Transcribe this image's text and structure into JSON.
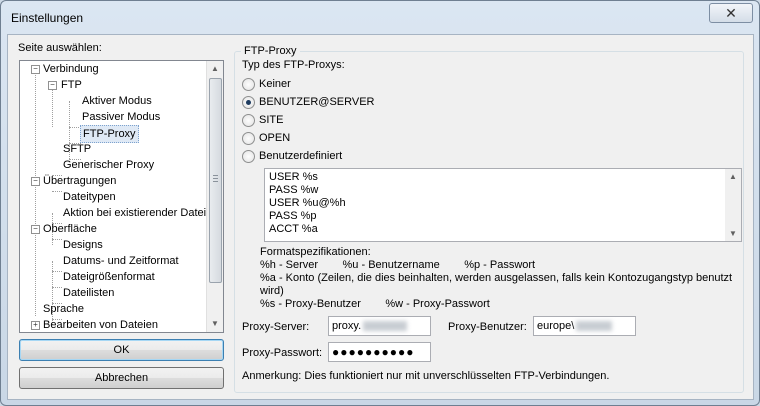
{
  "window": {
    "title": "Einstellungen",
    "close_symbol": "✕"
  },
  "sidebar": {
    "label": "Seite auswählen:",
    "items": [
      {
        "label": "Verbindung"
      },
      {
        "label": "FTP"
      },
      {
        "label": "Aktiver Modus"
      },
      {
        "label": "Passiver Modus"
      },
      {
        "label": "FTP-Proxy"
      },
      {
        "label": "SFTP"
      },
      {
        "label": "Generischer Proxy"
      },
      {
        "label": "Übertragungen"
      },
      {
        "label": "Dateitypen"
      },
      {
        "label": "Aktion bei existierender Datei"
      },
      {
        "label": "Oberfläche"
      },
      {
        "label": "Designs"
      },
      {
        "label": "Datums- und Zeitformat"
      },
      {
        "label": "Dateigrößenformat"
      },
      {
        "label": "Dateilisten"
      },
      {
        "label": "Sprache"
      },
      {
        "label": "Bearbeiten von Dateien"
      }
    ],
    "selected": "FTP-Proxy"
  },
  "buttons": {
    "ok": "OK",
    "cancel": "Abbrechen"
  },
  "proxy": {
    "group_title": "FTP-Proxy",
    "type_label": "Typ des FTP-Proxys:",
    "options": [
      {
        "label": "Keiner",
        "checked": false
      },
      {
        "label": "BENUTZER@SERVER",
        "checked": true
      },
      {
        "label": "SITE",
        "checked": false
      },
      {
        "label": "OPEN",
        "checked": false
      },
      {
        "label": "Benutzerdefiniert",
        "checked": false
      }
    ],
    "custom_lines": [
      "USER %s",
      "PASS %w",
      "USER %u@%h",
      "PASS %p",
      "ACCT %a"
    ],
    "format_title": "Formatspezifikationen:",
    "format_lines": [
      "%h - Server        %u - Benutzername        %p - Passwort",
      "%a - Konto (Zeilen, die dies beinhalten, werden ausgelassen, falls kein Kontozugangstyp benutzt",
      "wird)",
      "%s - Proxy-Benutzer        %w - Proxy-Passwort"
    ],
    "server_label": "Proxy-Server:",
    "server_value": "proxy.",
    "user_label": "Proxy-Benutzer:",
    "user_value": "europe\\",
    "password_label": "Proxy-Passwort:",
    "password_value": "●●●●●●●●●●",
    "note": "Anmerkung: Dies funktioniert nur mit unverschlüsselten FTP-Verbindungen."
  }
}
